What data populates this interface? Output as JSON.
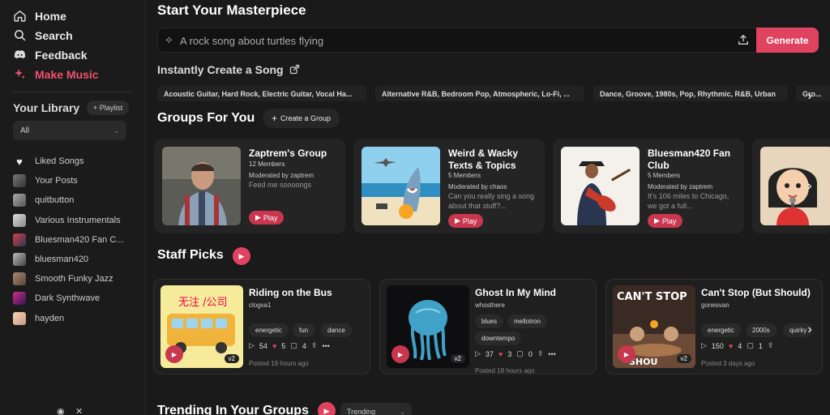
{
  "nav": {
    "home": "Home",
    "search": "Search",
    "feedback": "Feedback",
    "make_music": "Make Music"
  },
  "library": {
    "title": "Your Library",
    "playlist_button": "+ Playlist",
    "filter_value": "All",
    "items": [
      {
        "label": "Liked Songs",
        "icon": "heart-icon"
      },
      {
        "label": "Your Posts",
        "icon": "avatar-icon"
      },
      {
        "label": "quitbutton",
        "icon": "thumb"
      },
      {
        "label": "Various Instrumentals",
        "icon": "thumb"
      },
      {
        "label": "Bluesman420 Fan C...",
        "icon": "thumb"
      },
      {
        "label": "bluesman420",
        "icon": "thumb"
      },
      {
        "label": "Smooth Funky Jazz",
        "icon": "thumb"
      },
      {
        "label": "Dark Synthwave",
        "icon": "thumb"
      },
      {
        "label": "hayden",
        "icon": "thumb"
      }
    ]
  },
  "main": {
    "title": "Start Your Masterpiece",
    "prompt_placeholder": "A rock song about turtles flying",
    "generate_label": "Generate",
    "instant_title": "Instantly Create a Song",
    "instant_chips": [
      "Acoustic Guitar, Hard Rock, Electric Guitar, Vocal Ha...",
      "Alternative R&B, Bedroom Pop, Atmospheric, Lo-Fi, ...",
      "Dance, Groove, 1980s, Pop, Rhythmic, R&B, Urban",
      "Gro..."
    ],
    "groups_title": "Groups For You",
    "create_group_label": "Create a Group",
    "groups": [
      {
        "title": "Zaptrem's Group",
        "members": "12 Members",
        "moderator": "Moderated by zaptrem",
        "desc": "Feed me soooongs",
        "play": "Play"
      },
      {
        "title": "Weird & Wacky Texts & Topics",
        "members": "5 Members",
        "moderator": "Moderated by chaos",
        "desc": "Can you really sing a song about that stuff?...",
        "play": "Play"
      },
      {
        "title": "Bluesman420 Fan Club",
        "members": "5 Members",
        "moderator": "Moderated by zaptrem",
        "desc": "It's 106 miles to Chicago, we got a full...",
        "play": "Play"
      }
    ],
    "staff_title": "Staff Picks",
    "songs": [
      {
        "title": "Riding on the Bus",
        "artist": "clogva1",
        "tags": [
          "energetic",
          "fun",
          "dance"
        ],
        "plays": "54",
        "likes": "5",
        "comments": "4",
        "posted": "Posted 19 hours ago",
        "version": "v2"
      },
      {
        "title": "Ghost In My Mind",
        "artist": "whosthere",
        "tags": [
          "blues",
          "mellotron",
          "downtempo"
        ],
        "plays": "37",
        "likes": "3",
        "comments": "0",
        "posted": "Posted 18 hours ago",
        "version": "v2"
      },
      {
        "title": "Can't Stop (But Should)",
        "artist": "gonesvan",
        "tags": [
          "energetic",
          "2000s",
          "quirky"
        ],
        "plays": "150",
        "likes": "4",
        "comments": "1",
        "posted": "Posted 3 days ago",
        "version": "v2"
      }
    ],
    "trending_title": "Trending In Your Groups",
    "trending_select": "Trending"
  },
  "colors": {
    "accent": "#e0435f",
    "background": "#1a1a1a",
    "card": "#242424"
  }
}
